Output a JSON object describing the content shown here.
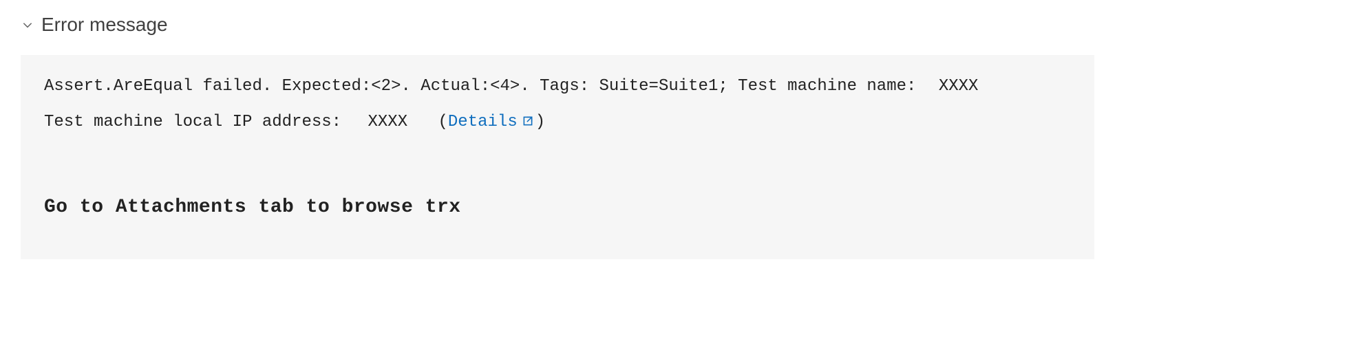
{
  "section": {
    "title": "Error message"
  },
  "error": {
    "assert_prefix": "Assert.AreEqual failed. Expected:<2>. Actual:<4>. Tags: Suite=Suite1; Test machine name:",
    "machine_name": "XXXX",
    "ip_label": "Test machine local IP address:",
    "ip_value": "XXXX",
    "paren_open": "(",
    "details_label": "Details",
    "paren_close": ")",
    "bold_note": "Go to Attachments tab to browse trx"
  }
}
